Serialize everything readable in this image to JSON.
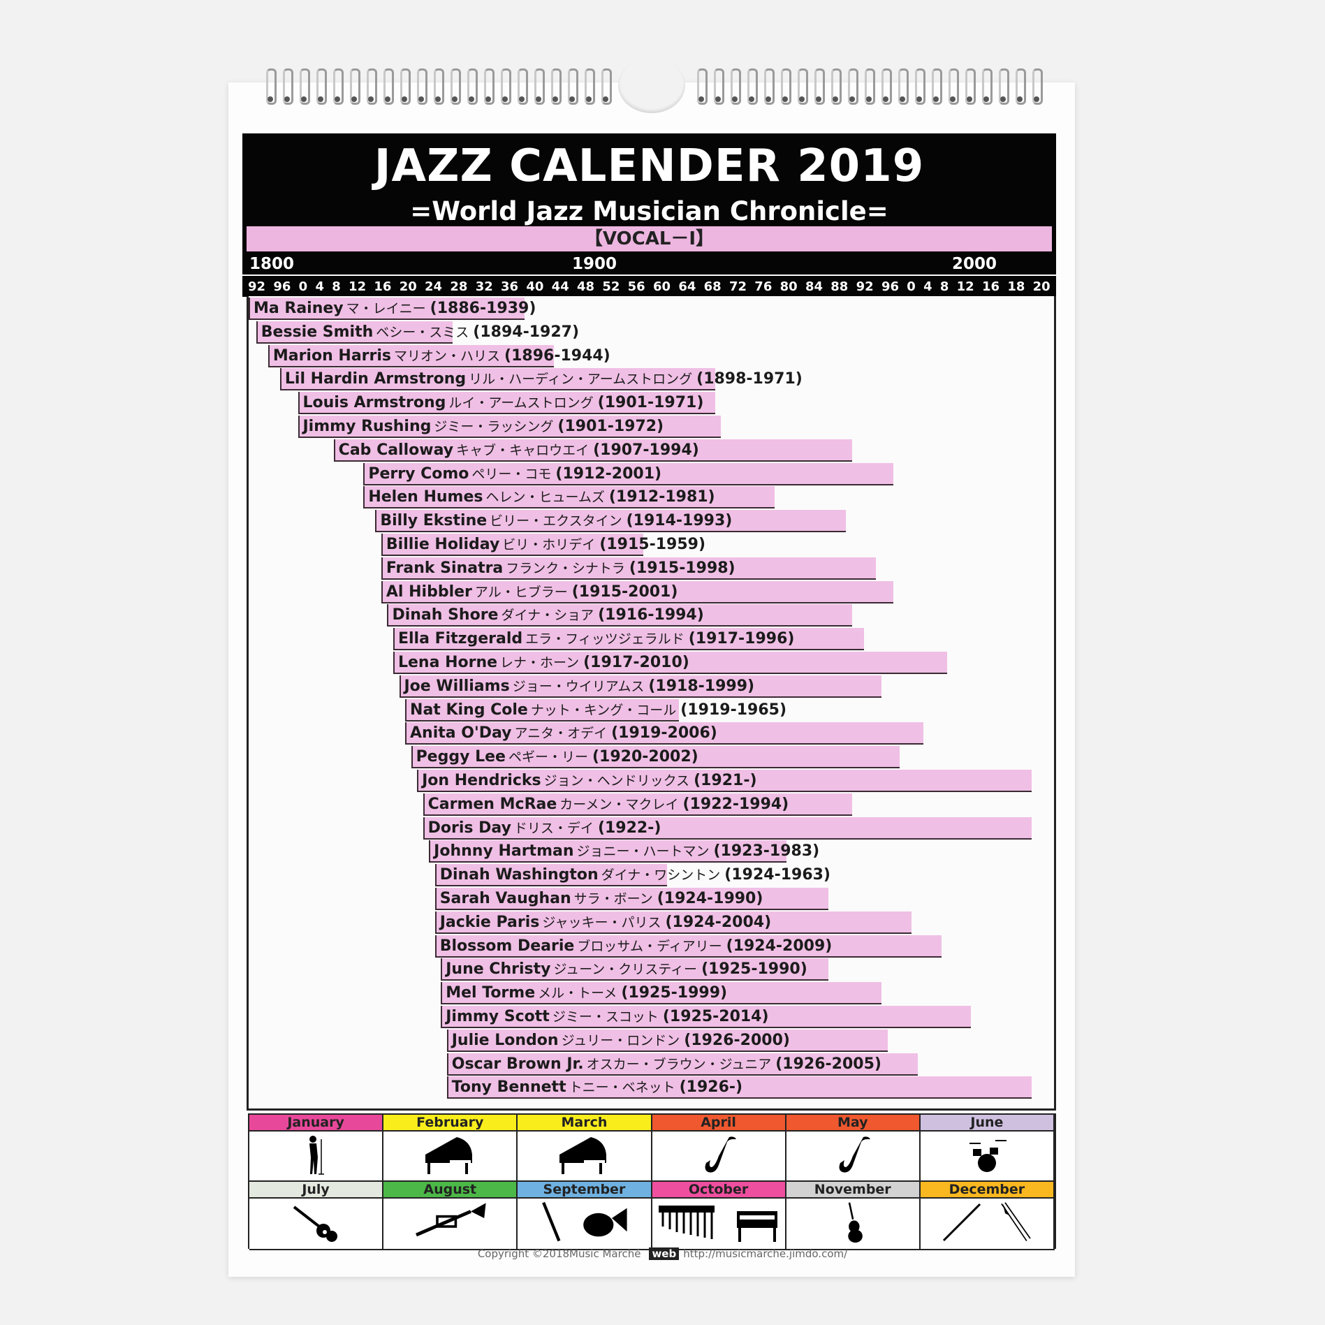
{
  "header": {
    "title": "JAZZ CALENDER 2019",
    "subtitle": "=World Jazz Musician Chronicle=",
    "category": "【VOCAL－Ⅰ】"
  },
  "colors": {
    "bar": "#f0bfe5",
    "header_bg": "#050505",
    "band": "#edb6e0"
  },
  "chart_data": {
    "type": "bar",
    "orientation": "horizontal-range",
    "title": "JAZZ CALENDER 2019",
    "subtitle": "=World Jazz Musician Chronicle=",
    "century_labels": [
      "1800",
      "1900",
      "2000"
    ],
    "tick_labels": [
      "92",
      "96",
      "0",
      "4",
      "8",
      "12",
      "16",
      "20",
      "24",
      "28",
      "32",
      "36",
      "40",
      "44",
      "48",
      "52",
      "56",
      "60",
      "64",
      "68",
      "72",
      "76",
      "80",
      "84",
      "88",
      "92",
      "96",
      "0",
      "4",
      "8",
      "12",
      "16",
      "18",
      "20"
    ],
    "xlim": [
      1890,
      2021
    ],
    "grid": false,
    "series": [
      {
        "name": "Ma Rainey",
        "ja": "マ・レイニー",
        "years": "(1886-1939)",
        "born": 1886,
        "died": 1939
      },
      {
        "name": "Bessie Smith",
        "ja": "ベシー・スミス",
        "years": "(1894-1927)",
        "born": 1894,
        "died": 1927
      },
      {
        "name": "Marion Harris",
        "ja": "マリオン・ハリス",
        "years": "(1896-1944)",
        "born": 1896,
        "died": 1944
      },
      {
        "name": "Lil Hardin Armstrong",
        "ja": "リル・ハーディン・アームストロング",
        "years": "(1898-1971)",
        "born": 1898,
        "died": 1971
      },
      {
        "name": "Louis Armstrong",
        "ja": "ルイ・アームストロング",
        "years": "(1901-1971)",
        "born": 1901,
        "died": 1971
      },
      {
        "name": "Jimmy Rushing",
        "ja": "ジミー・ラッシング",
        "years": "(1901-1972)",
        "born": 1901,
        "died": 1972
      },
      {
        "name": "Cab Calloway",
        "ja": "キャブ・キャロウエイ",
        "years": "(1907-1994)",
        "born": 1907,
        "died": 1994
      },
      {
        "name": "Perry Como",
        "ja": "ペリー・コモ",
        "years": "(1912-2001)",
        "born": 1912,
        "died": 2001
      },
      {
        "name": "Helen Humes",
        "ja": "ヘレン・ヒュームズ",
        "years": "(1912-1981)",
        "born": 1912,
        "died": 1981
      },
      {
        "name": "Billy Ekstine",
        "ja": "ビリー・エクスタイン",
        "years": "(1914-1993)",
        "born": 1914,
        "died": 1993
      },
      {
        "name": "Billie Holiday",
        "ja": "ビリ・ホリデイ",
        "years": "(1915-1959)",
        "born": 1915,
        "died": 1959
      },
      {
        "name": "Frank Sinatra",
        "ja": "フランク・シナトラ",
        "years": "(1915-1998)",
        "born": 1915,
        "died": 1998
      },
      {
        "name": "Al Hibbler",
        "ja": "アル・ヒブラー",
        "years": "(1915-2001)",
        "born": 1915,
        "died": 2001
      },
      {
        "name": "Dinah Shore",
        "ja": "ダイナ・ショア",
        "years": "(1916-1994)",
        "born": 1916,
        "died": 1994
      },
      {
        "name": "Ella Fitzgerald",
        "ja": "エラ・フィッツジェラルド",
        "years": "(1917-1996)",
        "born": 1917,
        "died": 1996
      },
      {
        "name": "Lena Horne",
        "ja": "レナ・ホーン",
        "years": "(1917-2010)",
        "born": 1917,
        "died": 2010
      },
      {
        "name": "Joe Williams",
        "ja": "ジョー・ウイリアムス",
        "years": "(1918-1999)",
        "born": 1918,
        "died": 1999
      },
      {
        "name": "Nat King Cole",
        "ja": "ナット・キング・コール",
        "years": "(1919-1965)",
        "born": 1919,
        "died": 1965
      },
      {
        "name": "Anita O'Day",
        "ja": "アニタ・オデイ",
        "years": "(1919-2006)",
        "born": 1919,
        "died": 2006
      },
      {
        "name": "Peggy Lee",
        "ja": "ペギー・リー",
        "years": "(1920-2002)",
        "born": 1920,
        "died": 2002
      },
      {
        "name": "Jon Hendricks",
        "ja": "ジョン・ヘンドリックス",
        "years": "(1921-)",
        "born": 1921,
        "died": null
      },
      {
        "name": "Carmen McRae",
        "ja": "カーメン・マクレイ",
        "years": "(1922-1994)",
        "born": 1922,
        "died": 1994
      },
      {
        "name": "Doris Day",
        "ja": "ドリス・デイ",
        "years": "(1922-)",
        "born": 1922,
        "died": null
      },
      {
        "name": "Johnny Hartman",
        "ja": "ジョニー・ハートマン",
        "years": "(1923-1983)",
        "born": 1923,
        "died": 1983
      },
      {
        "name": "Dinah Washington",
        "ja": "ダイナ・ワシントン",
        "years": "(1924-1963)",
        "born": 1924,
        "died": 1963
      },
      {
        "name": "Sarah Vaughan",
        "ja": "サラ・ボーン",
        "years": "(1924-1990)",
        "born": 1924,
        "died": 1990
      },
      {
        "name": "Jackie Paris",
        "ja": "ジャッキー・パリス",
        "years": "(1924-2004)",
        "born": 1924,
        "died": 2004
      },
      {
        "name": "Blossom Dearie",
        "ja": "ブロッサム・ディアリー",
        "years": "(1924-2009)",
        "born": 1924,
        "died": 2009
      },
      {
        "name": "June Christy",
        "ja": "ジューン・クリスティー",
        "years": "(1925-1990)",
        "born": 1925,
        "died": 1990
      },
      {
        "name": "Mel Torme",
        "ja": "メル・トーメ",
        "years": "(1925-1999)",
        "born": 1925,
        "died": 1999
      },
      {
        "name": "Jimmy Scott",
        "ja": "ジミー・スコット",
        "years": "(1925-2014)",
        "born": 1925,
        "died": 2014
      },
      {
        "name": "Julie London",
        "ja": "ジュリー・ロンドン",
        "years": "(1926-2000)",
        "born": 1926,
        "died": 2000
      },
      {
        "name": "Oscar Brown Jr.",
        "ja": "オスカー・ブラウン・ジュニア",
        "years": "(1926-2005)",
        "born": 1926,
        "died": 2005
      },
      {
        "name": "Tony Bennett",
        "ja": "トニー・ベネット",
        "years": "(1926-)",
        "born": 1926,
        "died": null
      }
    ]
  },
  "months": [
    {
      "label": "January",
      "color": "#e8489a",
      "icons": [
        "singer-icon"
      ]
    },
    {
      "label": "February",
      "color": "#f9ee1c",
      "icons": [
        "grand-piano-icon"
      ]
    },
    {
      "label": "March",
      "color": "#f9ee1c",
      "icons": [
        "grand-piano-icon"
      ]
    },
    {
      "label": "April",
      "color": "#f0582f",
      "icons": [
        "saxophone-icon"
      ]
    },
    {
      "label": "May",
      "color": "#f0582f",
      "icons": [
        "saxophone-icon"
      ]
    },
    {
      "label": "June",
      "color": "#cfc0e0",
      "icons": [
        "drum-kit-icon"
      ]
    },
    {
      "label": "July",
      "color": "#e4e9df",
      "icons": [
        "guitar-icon"
      ]
    },
    {
      "label": "August",
      "color": "#4cb848",
      "icons": [
        "trumpet-icon"
      ]
    },
    {
      "label": "September",
      "color": "#6fb1e0",
      "icons": [
        "clarinet-icon",
        "flugelhorn-icon"
      ]
    },
    {
      "label": "October",
      "color": "#ee4f9f",
      "icons": [
        "vibraphone-icon",
        "electric-piano-icon"
      ]
    },
    {
      "label": "November",
      "color": "#d2d2d2",
      "icons": [
        "double-bass-icon"
      ]
    },
    {
      "label": "December",
      "color": "#f9b820",
      "icons": [
        "flute-icon",
        "trombone-icon"
      ]
    }
  ],
  "footer": {
    "copyright": "Copyright ©2018Music Marché",
    "web_badge": "web",
    "url": "http://musicmarche.jimdo.com/"
  }
}
